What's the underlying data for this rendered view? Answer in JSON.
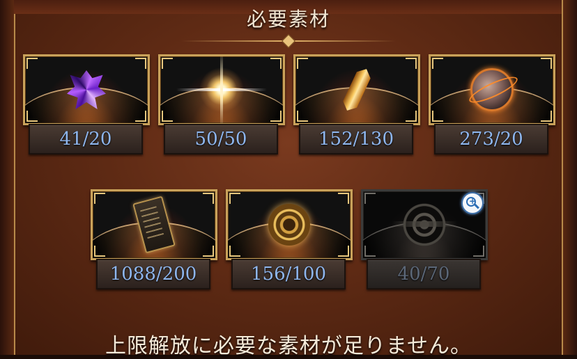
{
  "header": {
    "title": "必要素材"
  },
  "materials": [
    {
      "icon": "purple-crystal-icon",
      "count": "41/20",
      "available": true
    },
    {
      "icon": "star-burst-icon",
      "count": "50/50",
      "available": true
    },
    {
      "icon": "amber-crystal-icon",
      "count": "152/130",
      "available": true
    },
    {
      "icon": "ore-sphere-icon",
      "count": "273/20",
      "available": true
    },
    {
      "icon": "ancient-scroll-icon",
      "count": "1088/200",
      "available": true
    },
    {
      "icon": "gold-medallion-icon",
      "count": "156/100",
      "available": true
    },
    {
      "icon": "emblem-icon",
      "count": "40/70",
      "available": false
    }
  ],
  "footer": {
    "message": "上限解放に必要な素材が足りません。"
  },
  "colors": {
    "count_text": "#8eb6ee",
    "insufficient_text": "#5b6778",
    "frame_gold": "#c9a25a"
  }
}
